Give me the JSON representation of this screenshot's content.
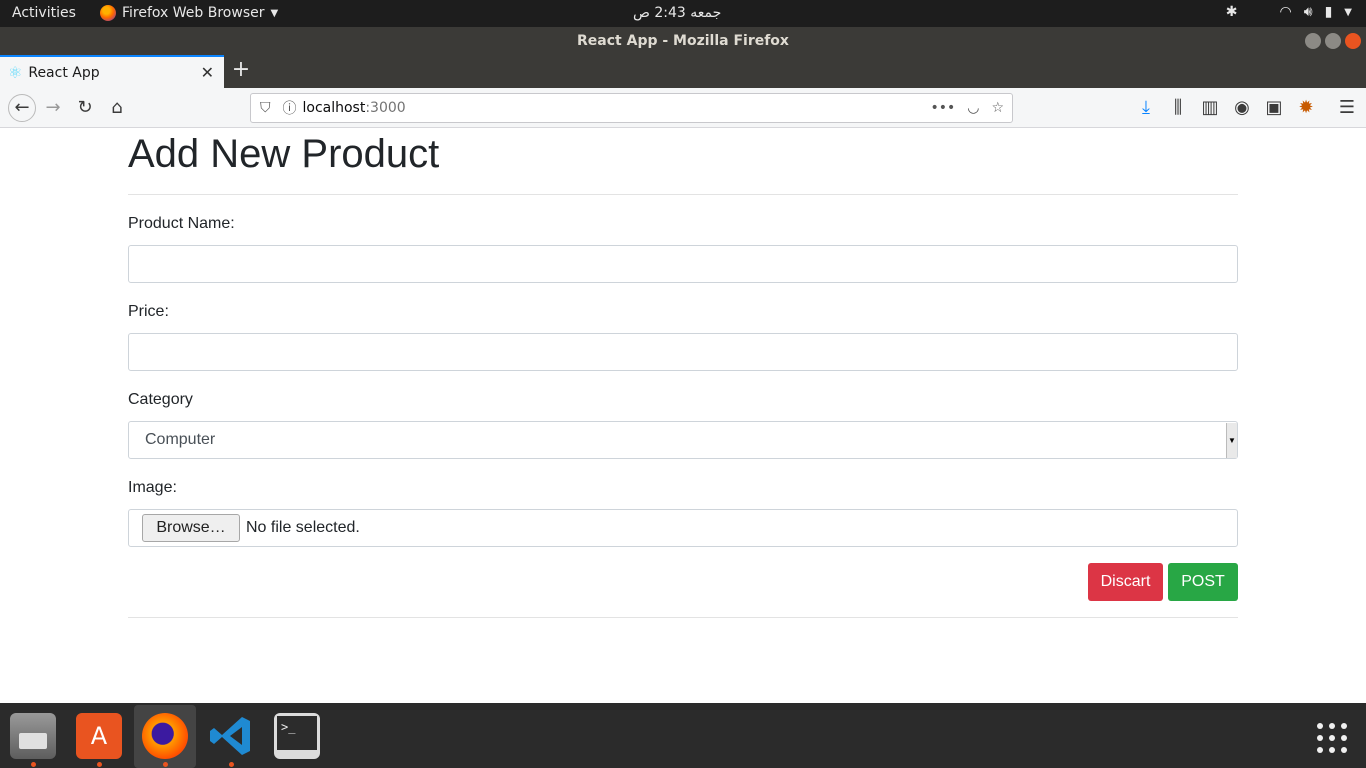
{
  "topbar": {
    "activities": "Activities",
    "app_name": "Firefox Web Browser",
    "clock": "جمعه  2:43 ص"
  },
  "window": {
    "title": "React App - Mozilla Firefox"
  },
  "tab": {
    "title": "React App"
  },
  "urlbar": {
    "host": "localhost",
    "port": ":3000"
  },
  "form": {
    "heading": "Add New Product",
    "product_name_label": "Product Name:",
    "product_name_value": "",
    "price_label": "Price:",
    "price_value": "",
    "category_label": "Category",
    "category_selected": "Computer",
    "image_label": "Image:",
    "browse_label": "Browse…",
    "file_status": "No file selected.",
    "discard_label": "Discart",
    "post_label": "POST"
  },
  "colors": {
    "discard_bg": "#dc3545",
    "post_bg": "#28a745",
    "tab_accent": "#0a84ff"
  },
  "dock": {
    "items": [
      "files-icon",
      "software-icon",
      "firefox-icon",
      "vscode-icon",
      "terminal-icon"
    ]
  }
}
